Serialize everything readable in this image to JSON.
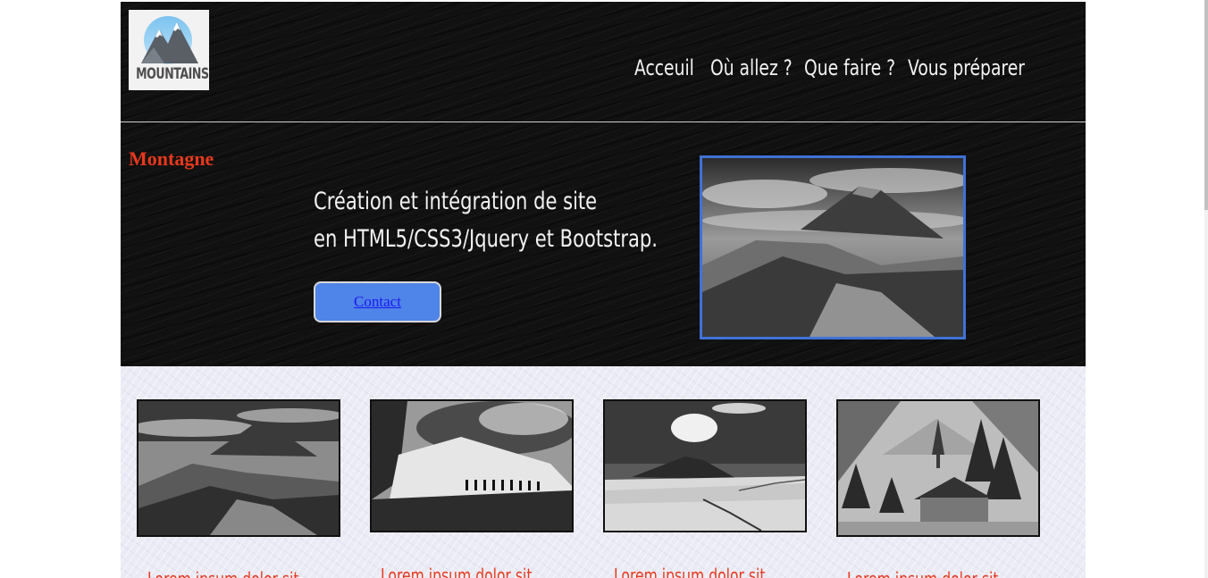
{
  "logo": {
    "text": "MOUNTAINS"
  },
  "nav": {
    "items": [
      "Acceuil",
      "Où allez ?",
      "Que faire ?",
      "Vous préparer"
    ]
  },
  "hero": {
    "title": "Montagne",
    "line1": "Création et intégration de site",
    "line2": "en HTML5/CSS3/Jquery et Bootstrap.",
    "contact_label": "Contact"
  },
  "gallery": {
    "cards": [
      {
        "caption": "Lorem ipsum dolor sit"
      },
      {
        "caption": "Lorem ipsum dolor sit"
      },
      {
        "caption": "Lorem ipsum dolor sit"
      },
      {
        "caption": "Lorem ipsum dolor sit"
      }
    ]
  },
  "colors": {
    "header_bg": "#111111",
    "accent_red": "#e8391c",
    "button_blue": "#4f84e8",
    "photo_border": "#3f72d6",
    "gallery_bg": "#ebebf6"
  }
}
